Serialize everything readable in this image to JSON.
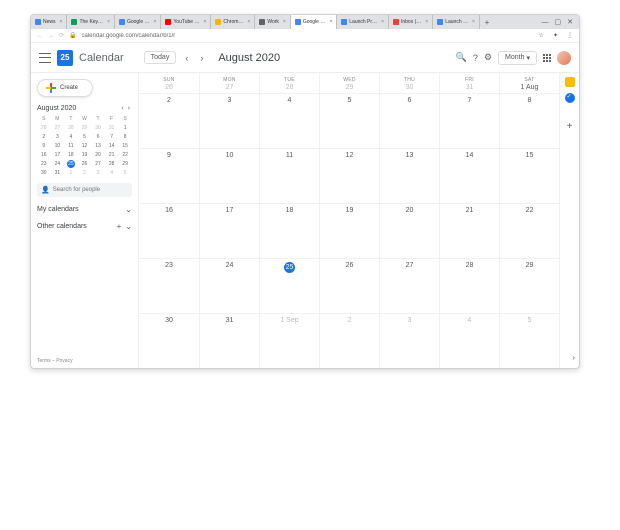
{
  "browser": {
    "tabs": [
      {
        "label": "News",
        "fav": "#4285f4"
      },
      {
        "label": "The Key…",
        "fav": "#0f9d58"
      },
      {
        "label": "Google …",
        "fav": "#4285f4"
      },
      {
        "label": "YouTube …",
        "fav": "#ff0000"
      },
      {
        "label": "Chrom…",
        "fav": "#f4b400"
      },
      {
        "label": "Work",
        "fav": "#5f6368"
      },
      {
        "label": "Google …",
        "fav": "#4285f4",
        "active": true
      },
      {
        "label": "Launch Pr…",
        "fav": "#4285f4"
      },
      {
        "label": "Inbox (…",
        "fav": "#ea4335"
      },
      {
        "label": "Launch …",
        "fav": "#4285f4"
      }
    ],
    "url": "calendar.google.com/calendar/b/1/r"
  },
  "appbar": {
    "icon_day": "25",
    "title": "Calendar",
    "today": "Today",
    "period": "August 2020",
    "view": "Month"
  },
  "sidebar": {
    "create": "Create",
    "mini_month": "August 2020",
    "mini_dow": [
      "S",
      "M",
      "T",
      "W",
      "T",
      "F",
      "S"
    ],
    "mini_rows": [
      [
        {
          "n": "26",
          "dim": true
        },
        {
          "n": "27",
          "dim": true
        },
        {
          "n": "28",
          "dim": true
        },
        {
          "n": "29",
          "dim": true
        },
        {
          "n": "30",
          "dim": true
        },
        {
          "n": "31",
          "dim": true
        },
        {
          "n": "1"
        }
      ],
      [
        {
          "n": "2"
        },
        {
          "n": "3"
        },
        {
          "n": "4"
        },
        {
          "n": "5"
        },
        {
          "n": "6"
        },
        {
          "n": "7"
        },
        {
          "n": "8"
        }
      ],
      [
        {
          "n": "9"
        },
        {
          "n": "10"
        },
        {
          "n": "11"
        },
        {
          "n": "12"
        },
        {
          "n": "13"
        },
        {
          "n": "14"
        },
        {
          "n": "15"
        }
      ],
      [
        {
          "n": "16"
        },
        {
          "n": "17"
        },
        {
          "n": "18"
        },
        {
          "n": "19"
        },
        {
          "n": "20"
        },
        {
          "n": "21"
        },
        {
          "n": "22"
        }
      ],
      [
        {
          "n": "23"
        },
        {
          "n": "24"
        },
        {
          "n": "25",
          "today": true
        },
        {
          "n": "26"
        },
        {
          "n": "27"
        },
        {
          "n": "28"
        },
        {
          "n": "29"
        }
      ],
      [
        {
          "n": "30"
        },
        {
          "n": "31"
        },
        {
          "n": "1",
          "dim": true
        },
        {
          "n": "2",
          "dim": true
        },
        {
          "n": "3",
          "dim": true
        },
        {
          "n": "4",
          "dim": true
        },
        {
          "n": "5",
          "dim": true
        }
      ]
    ],
    "search_placeholder": "Search for people",
    "my_cal": "My calendars",
    "other_cal": "Other calendars",
    "footer_terms": "Terms",
    "footer_privacy": "Privacy"
  },
  "grid": {
    "dow": [
      "SUN",
      "MON",
      "TUE",
      "WED",
      "THU",
      "FRI",
      "SAT"
    ],
    "head_nums": [
      {
        "n": "26",
        "dim": true
      },
      {
        "n": "27",
        "dim": true
      },
      {
        "n": "28",
        "dim": true
      },
      {
        "n": "29",
        "dim": true
      },
      {
        "n": "30",
        "dim": true
      },
      {
        "n": "31",
        "dim": true
      },
      {
        "n": "1 Aug"
      }
    ],
    "rows": [
      [
        {
          "n": "2"
        },
        {
          "n": "3"
        },
        {
          "n": "4"
        },
        {
          "n": "5"
        },
        {
          "n": "6"
        },
        {
          "n": "7"
        },
        {
          "n": "8"
        }
      ],
      [
        {
          "n": "9"
        },
        {
          "n": "10"
        },
        {
          "n": "11"
        },
        {
          "n": "12"
        },
        {
          "n": "13"
        },
        {
          "n": "14"
        },
        {
          "n": "15"
        }
      ],
      [
        {
          "n": "16"
        },
        {
          "n": "17"
        },
        {
          "n": "18"
        },
        {
          "n": "19"
        },
        {
          "n": "20"
        },
        {
          "n": "21"
        },
        {
          "n": "22"
        }
      ],
      [
        {
          "n": "23"
        },
        {
          "n": "24"
        },
        {
          "n": "25",
          "today": true
        },
        {
          "n": "26"
        },
        {
          "n": "27"
        },
        {
          "n": "28"
        },
        {
          "n": "29"
        }
      ],
      [
        {
          "n": "30"
        },
        {
          "n": "31"
        },
        {
          "n": "1 Sep",
          "dim": true
        },
        {
          "n": "2",
          "dim": true
        },
        {
          "n": "3",
          "dim": true
        },
        {
          "n": "4",
          "dim": true
        },
        {
          "n": "5",
          "dim": true
        }
      ]
    ]
  }
}
